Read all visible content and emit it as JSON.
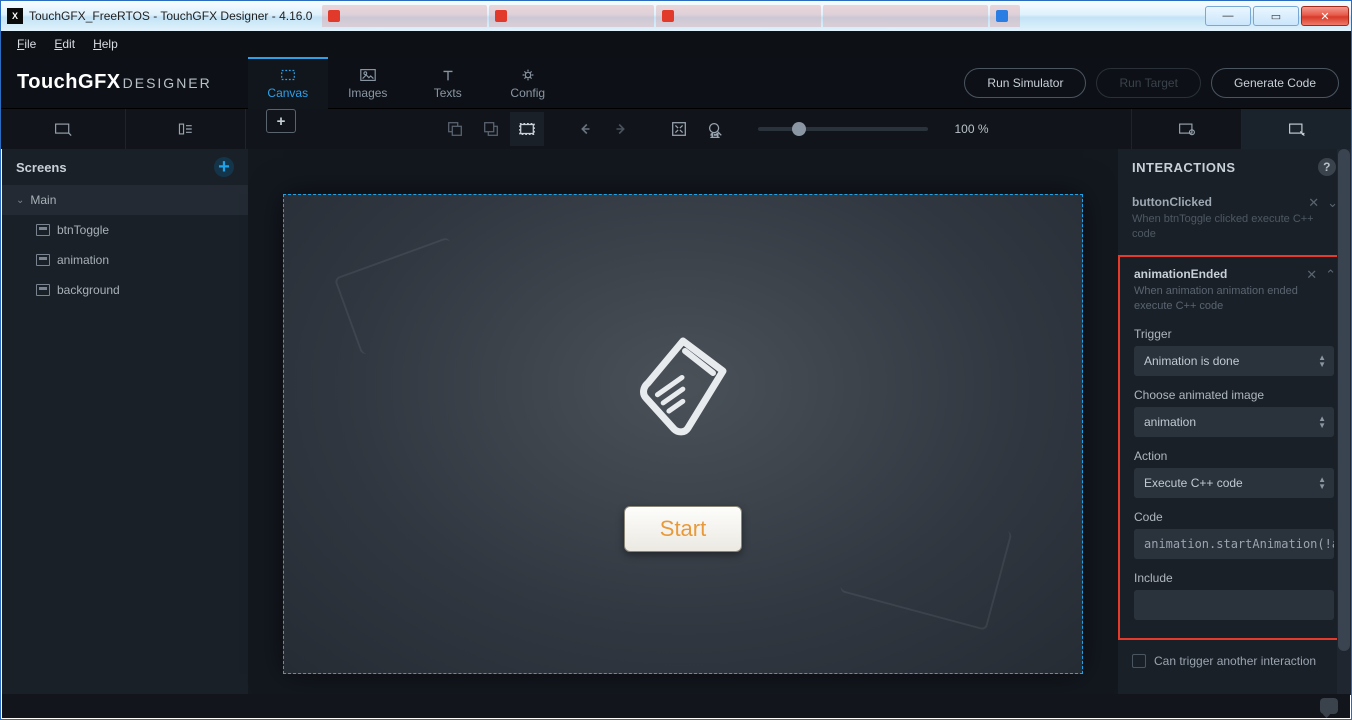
{
  "window": {
    "title": "TouchGFX_FreeRTOS - TouchGFX Designer - 4.16.0"
  },
  "menu": {
    "file": "File",
    "edit": "Edit",
    "help": "Help"
  },
  "logo": {
    "main": "TouchGFX",
    "sub": "DESIGNER"
  },
  "modes": {
    "canvas": "Canvas",
    "images": "Images",
    "texts": "Texts",
    "config": "Config"
  },
  "header": {
    "run_sim": "Run Simulator",
    "run_target": "Run Target",
    "gen_code": "Generate Code"
  },
  "toolbar": {
    "zoom": "100 %"
  },
  "sidebar": {
    "title": "Screens",
    "root": "Main",
    "items": [
      "btnToggle",
      "animation",
      "background"
    ]
  },
  "canvas": {
    "start": "Start"
  },
  "rpanel": {
    "title": "INTERACTIONS",
    "int1": {
      "title": "buttonClicked",
      "desc": "When btnToggle clicked execute C++ code"
    },
    "int2": {
      "title": "animationEnded",
      "desc": "When animation animation ended execute C++ code",
      "trigger_l": "Trigger",
      "trigger_v": "Animation is done",
      "choose_l": "Choose animated image",
      "choose_v": "animation",
      "action_l": "Action",
      "action_v": "Execute C++ code",
      "code_l": "Code",
      "code_v": "animation.startAnimation(!anim",
      "include_l": "Include",
      "check": "Can trigger another interaction"
    }
  }
}
